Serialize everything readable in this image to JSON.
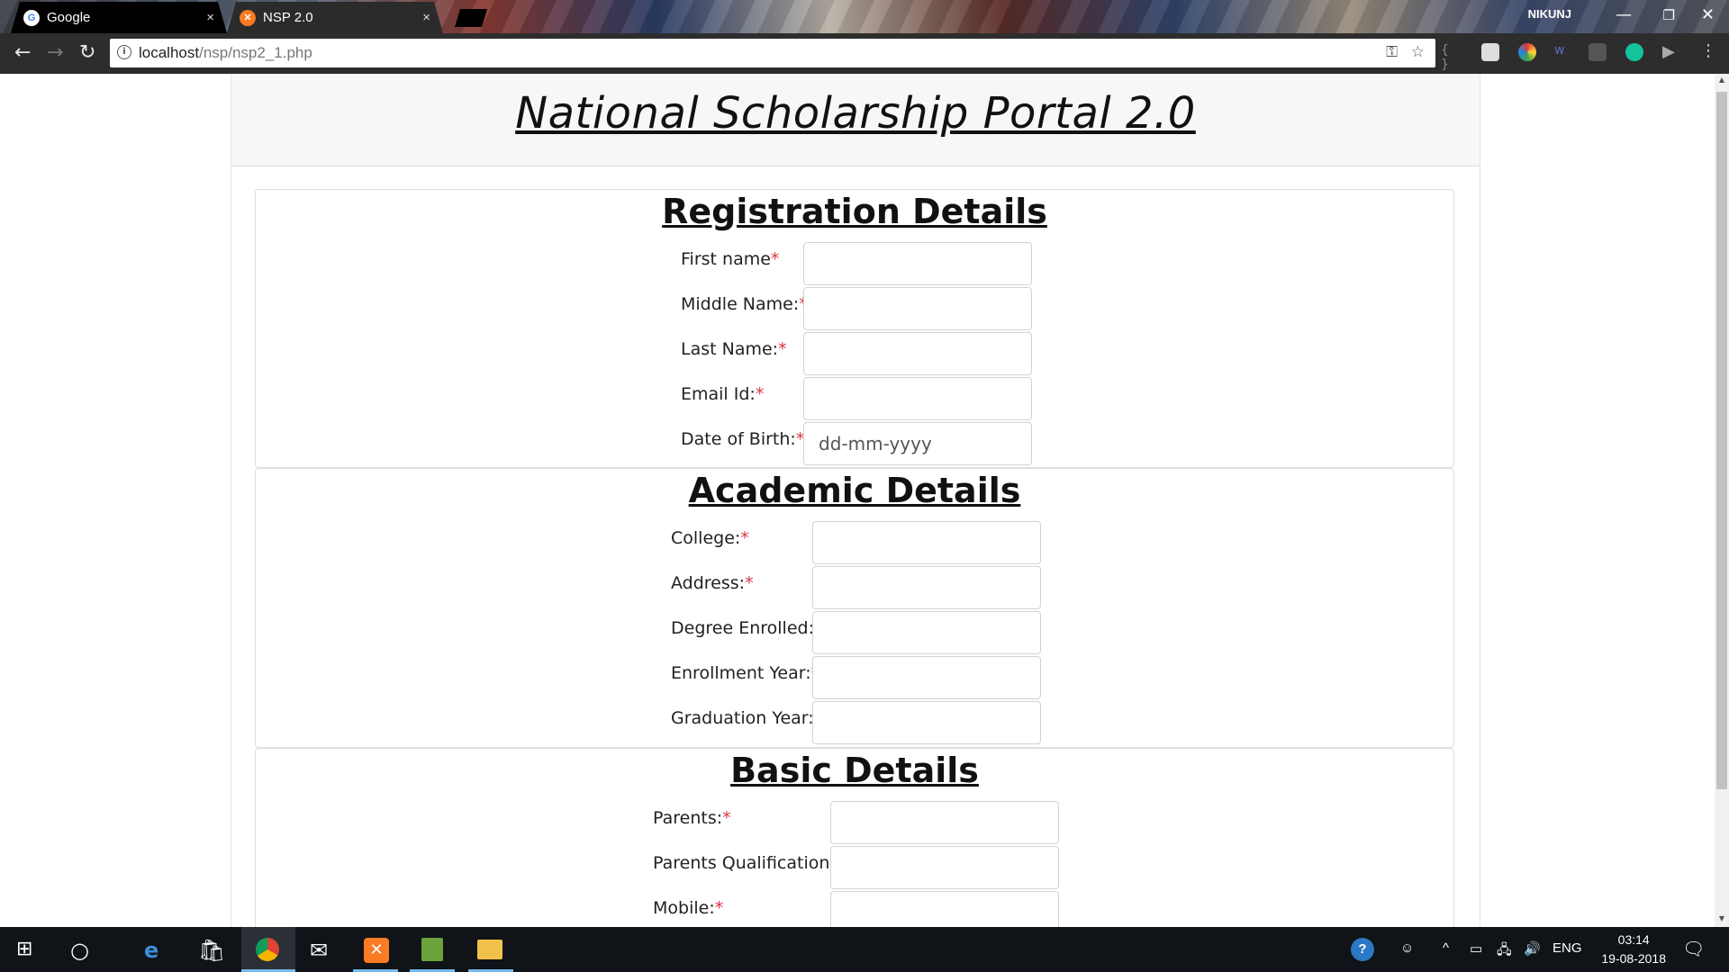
{
  "browser": {
    "tabs": [
      {
        "title": "Google",
        "close": "×"
      },
      {
        "title": "NSP 2.0",
        "close": "×"
      }
    ],
    "profile_name": "NIKUNJ",
    "url_host": "localhost",
    "url_path": "/nsp/nsp2_1.php",
    "window_controls": {
      "minimize": "—",
      "restore": "❐",
      "close": "✕"
    }
  },
  "page": {
    "title": "National Scholarship Portal 2.0",
    "required_mark": "*",
    "sections": [
      {
        "heading": "Registration Details",
        "fields": [
          {
            "label": "First name",
            "value": "",
            "placeholder": ""
          },
          {
            "label": "Middle Name:",
            "value": "",
            "placeholder": ""
          },
          {
            "label": "Last Name:",
            "value": "",
            "placeholder": ""
          },
          {
            "label": "Email Id:",
            "value": "",
            "placeholder": ""
          },
          {
            "label": "Date of Birth:",
            "value": "",
            "placeholder": "dd-mm-yyyy"
          }
        ]
      },
      {
        "heading": "Academic Details",
        "fields": [
          {
            "label": "College:",
            "value": "",
            "placeholder": ""
          },
          {
            "label": "Address:",
            "value": "",
            "placeholder": ""
          },
          {
            "label": "Degree Enrolled:",
            "value": "",
            "placeholder": ""
          },
          {
            "label": "Enrollment Year:",
            "value": "",
            "placeholder": ""
          },
          {
            "label": "Graduation Year:",
            "value": "",
            "placeholder": ""
          }
        ]
      },
      {
        "heading": "Basic Details",
        "fields": [
          {
            "label": "Parents:",
            "value": "",
            "placeholder": ""
          },
          {
            "label": "Parents Qualification:",
            "value": "",
            "placeholder": ""
          },
          {
            "label": "Mobile:",
            "value": "",
            "placeholder": ""
          }
        ]
      }
    ]
  },
  "taskbar": {
    "language": "ENG",
    "time": "03:14",
    "date": "19-08-2018"
  }
}
